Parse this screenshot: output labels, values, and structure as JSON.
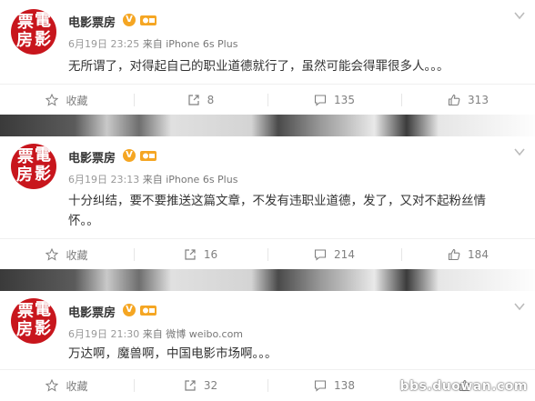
{
  "watermark": "bbs.duowan.com",
  "posts": [
    {
      "username": "电影票房",
      "avatar_chars": [
        "票",
        "電",
        "房",
        "影"
      ],
      "time": "6月19日 23:25",
      "source": "来自 iPhone 6s Plus",
      "content": "无所谓了，对得起自己的职业道德就行了，虽然可能会得罪很多人。。。",
      "favorite_label": "收藏",
      "repost_count": "8",
      "comment_count": "135",
      "like_count": "313"
    },
    {
      "username": "电影票房",
      "avatar_chars": [
        "票",
        "電",
        "房",
        "影"
      ],
      "time": "6月19日 23:13",
      "source": "来自 iPhone 6s Plus",
      "content": "十分纠结，要不要推送这篇文章，不发有违职业道德，发了，又对不起粉丝情怀。。",
      "favorite_label": "收藏",
      "repost_count": "16",
      "comment_count": "214",
      "like_count": "184"
    },
    {
      "username": "电影票房",
      "avatar_chars": [
        "票",
        "電",
        "房",
        "影"
      ],
      "time": "6月19日 21:30",
      "source": "来自 微博 weibo.com",
      "content": "万达啊，魔兽啊，中国电影市场啊。。。",
      "favorite_label": "收藏",
      "repost_count": "32",
      "comment_count": "138",
      "like_count": ""
    }
  ],
  "colors": {
    "avatar_red": "#c8161d",
    "vip_orange": "#f5a623",
    "text_primary": "#333333",
    "text_meta": "#999999"
  }
}
